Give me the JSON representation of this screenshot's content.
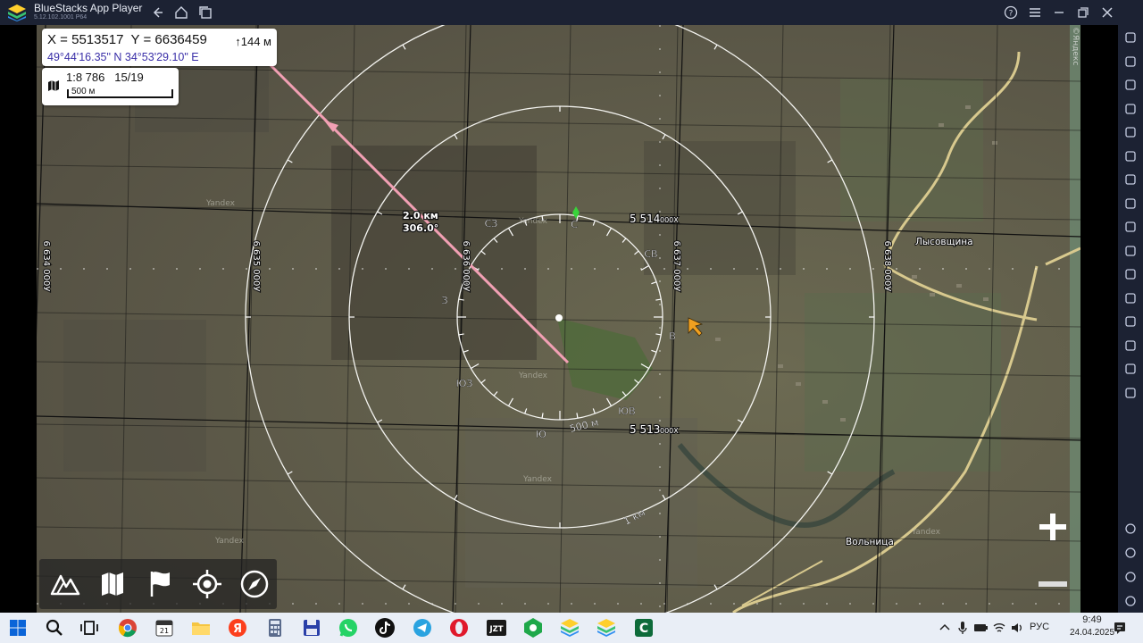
{
  "window": {
    "title": "BlueStacks App Player",
    "version": "5.12.102.1001 P64"
  },
  "coords": {
    "xy": "X = 5513517  Y = 6636459",
    "altitude": "↑144 м",
    "latlon": "49°44'16.35\" N 34°53'29.10\" E"
  },
  "scale": {
    "ratio": "1:8 786",
    "zoom": "15/19",
    "bar_label": "500 м"
  },
  "measure": {
    "distance": "2.0 км",
    "bearing": "306.0°"
  },
  "rings": {
    "inner_label": "500 м",
    "outer_label": "1 км"
  },
  "compass": [
    "С",
    "СВ",
    "В",
    "ЮВ",
    "Ю",
    "ЮЗ",
    "З",
    "СЗ"
  ],
  "grid": {
    "h_top": "5 514",
    "h_bottom": "5 513",
    "h_suffix": "000Х",
    "v_labels": [
      "6 634",
      "6 635",
      "6 636",
      "6 637",
      "6 638"
    ],
    "v_suffix": "000У"
  },
  "places": {
    "village_1": "Лысовщина",
    "village_2": "Вольница",
    "watermark": "Yandex",
    "attribution": "©Яндекс"
  },
  "toolbar": [
    "terrain-tool",
    "map-layers-tool",
    "flag-tool",
    "locate-tool",
    "compass-tool"
  ],
  "zoom": {
    "plus": "+",
    "minus": "−"
  },
  "tray": {
    "language": "РУС",
    "time": "9:49",
    "date": "24.04.2025"
  },
  "colors": {
    "measure_line": "#f2a0b4",
    "coord_latlon": "#3a2fa8",
    "titlebar": "#1c2233",
    "taskbar": "#e9eef6"
  }
}
